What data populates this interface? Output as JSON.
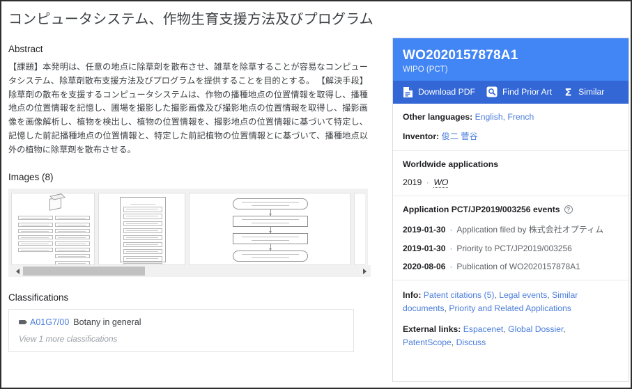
{
  "document": {
    "title": "コンピュータシステム、作物生育支援方法及びプログラム",
    "abstract_heading": "Abstract",
    "abstract_text": "【課題】本発明は、任意の地点に除草剤を散布させ、雑草を除草することが容易なコンピュータシステム、除草剤散布支援方法及びプログラムを提供することを目的とする。 【解決手段】除草剤の散布を支援するコンピュータシステムは、作物の播種地点の位置情報を取得し、播種地点の位置情報を記憶し、圃場を撮影した撮影画像及び撮影地点の位置情報を取得し、撮影画像を画像解析し、植物を検出し、植物の位置情報を、撮影地点の位置情報に基づいて特定し、記憶した前記播種地点の位置情報と、特定した前記植物の位置情報とに基づいて、播種地点以外の植物に除草剤を散布させる。"
  },
  "images": {
    "heading": "Images (8)",
    "count": 8
  },
  "classifications": {
    "heading": "Classifications",
    "items": [
      {
        "code": "A01G7/00",
        "description": "Botany in general"
      }
    ],
    "more_label": "View 1 more classifications"
  },
  "patent_card": {
    "publication_number": "WO2020157878A1",
    "authority": "WIPO (PCT)",
    "actions": [
      {
        "label": "Download PDF",
        "icon": "document-download-icon"
      },
      {
        "label": "Find Prior Art",
        "icon": "prior-art-search-icon"
      },
      {
        "label": "Similar",
        "icon": "sigma-similar-icon"
      }
    ],
    "meta": {
      "other_languages_label": "Other languages:",
      "other_languages_value": "English, French",
      "inventor_label": "Inventor:",
      "inventor_value": "俊二 菅谷"
    },
    "worldwide": {
      "title": "Worldwide applications",
      "rows": [
        {
          "year": "2019",
          "codes": "WO"
        }
      ]
    },
    "events": {
      "title": "Application PCT/JP2019/003256 events",
      "help_icon": "help-question-icon",
      "items": [
        {
          "date": "2019-01-30",
          "text": "Application filed by 株式会社オプティム"
        },
        {
          "date": "2019-01-30",
          "text": "Priority to PCT/JP2019/003256"
        },
        {
          "date": "2020-08-06",
          "text": "Publication of WO2020157878A1"
        }
      ]
    },
    "links": {
      "info_label": "Info:",
      "info_links": [
        "Patent citations (5)",
        "Legal events",
        "Similar documents",
        "Priority and Related Applications"
      ],
      "external_label": "External links:",
      "external_links": [
        "Espacenet",
        "Global Dossier",
        "PatentScope",
        "Discuss"
      ]
    }
  },
  "colors": {
    "header_blue": "#4285f4",
    "action_blue": "#3367d6",
    "link_blue": "#4a7ddb",
    "text_primary": "#202124",
    "text_secondary": "#5f6368"
  }
}
